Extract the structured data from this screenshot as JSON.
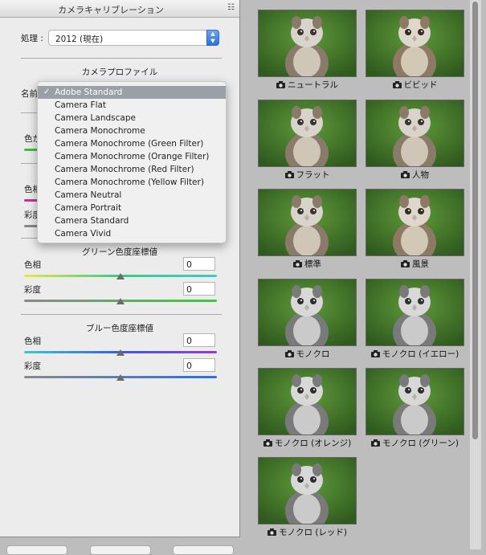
{
  "panel": {
    "title": "カメラキャリブレーション",
    "menu_icon": "panel-menu-icon",
    "process_label": "処理 :",
    "process_value": "2012 (現在)",
    "profile_section": "カメラプロファイル",
    "name_label": "名前",
    "hue_label_partial": "色か",
    "hue_label_partial2": "色相",
    "sat_label_partial": "彩度",
    "green_section": "グリーン色度座標値",
    "green_hue_label": "色相",
    "green_hue_value": "0",
    "green_sat_label": "彩度",
    "green_sat_value": "0",
    "blue_section": "ブルー色度座標値",
    "blue_hue_label": "色相",
    "blue_hue_value": "0",
    "blue_sat_label": "彩度",
    "blue_sat_value": "0"
  },
  "dropdown": {
    "check": "✓",
    "items": [
      "Adobe Standard",
      "Camera Flat",
      "Camera Landscape",
      "Camera Monochrome",
      "Camera Monochrome (Green Filter)",
      "Camera Monochrome (Orange Filter)",
      "Camera Monochrome (Red Filter)",
      "Camera Monochrome (Yellow Filter)",
      "Camera Neutral",
      "Camera Portrait",
      "Camera Standard",
      "Camera Vivid"
    ],
    "selected_index": 0
  },
  "thumbnails": [
    {
      "caption": "ニュートラル",
      "mode": "color"
    },
    {
      "caption": "ビビッド",
      "mode": "vivid"
    },
    {
      "caption": "フラット",
      "mode": "color"
    },
    {
      "caption": "人物",
      "mode": "color"
    },
    {
      "caption": "標準",
      "mode": "color"
    },
    {
      "caption": "風景",
      "mode": "vivid"
    },
    {
      "caption": "モノクロ",
      "mode": "mono"
    },
    {
      "caption": "モノクロ (イエロー)",
      "mode": "mono"
    },
    {
      "caption": "モノクロ (オレンジ)",
      "mode": "mono"
    },
    {
      "caption": "モノクロ (グリーン)",
      "mode": "mono"
    },
    {
      "caption": "モノクロ (レッド)",
      "mode": "mono"
    }
  ],
  "colors": {
    "panel_bg": "#ececec",
    "dropdown_selected": "#9aa0a6",
    "select_accent": "#2e6fd7"
  }
}
